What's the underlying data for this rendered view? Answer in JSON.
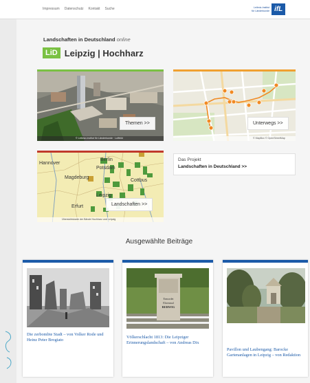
{
  "nav": [
    "Impressum",
    "Datenschutz",
    "Kontakt",
    "Suche"
  ],
  "institute": {
    "line1": "Leibniz-Institut",
    "line2": "für Länderkunde",
    "logo": "ifL"
  },
  "subtitle": {
    "bold": "Landschaften in Deutschland",
    "italic": "online"
  },
  "badge": "LiD",
  "site_title": "Leipzig | Hochharz",
  "tiles": {
    "themen": {
      "label": "Themen >>",
      "footer": "© Leibniz-Institut für Länderkunde · Luftbild",
      "accent": "#7ac143"
    },
    "unterwegs": {
      "label": "Unterwegs >>",
      "footer": "© MapBox © OpenStreetMap",
      "accent": "#f0a030"
    },
    "landschaften": {
      "label": "Landschaften >>",
      "footer": "Übersichtskarte der Bände Hochharz und Leipzig",
      "accent": "#c0392b"
    },
    "map_labels": [
      "Hannover",
      "Berlin",
      "Potsdam",
      "Magdeburg",
      "Cottbus",
      "Leipzig",
      "Erfurt"
    ]
  },
  "projekt": {
    "line1": "Das Projekt",
    "line2": "Landschaften in Deutschland >>"
  },
  "section_title": "Ausgewählte Beiträge",
  "articles": [
    {
      "caption": "Die zerbombte Stadt – von Volker Rode und Heinz Peter Brogiato"
    },
    {
      "caption": "Völkerschlacht 1813: Die Leipziger Erinnerungslandschaft – von Andreas Dix"
    },
    {
      "caption": "Pavillon und Laubengang: Barocke Gartenanlagen in Leipzig – von Redaktion"
    }
  ],
  "stone_text": [
    "Ermordet",
    "Ehrenmal",
    "BERWIG"
  ],
  "colors": {
    "brand_blue": "#1b5aa8",
    "lid_green": "#7ac143"
  }
}
